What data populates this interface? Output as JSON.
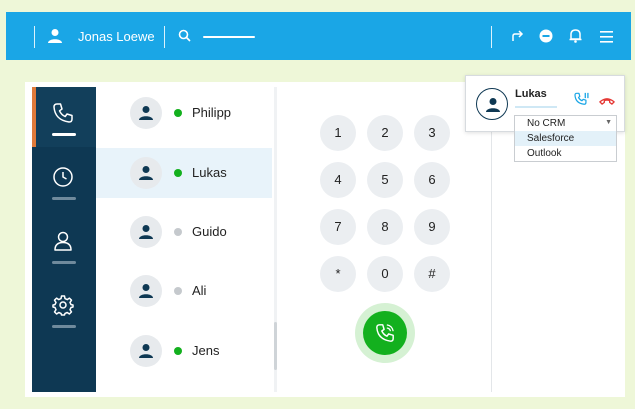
{
  "topbar": {
    "user_name": "Jonas Loewe",
    "icons": [
      "user-icon",
      "search-icon",
      "forward-icon",
      "dnd-icon",
      "bell-icon",
      "menu-icon"
    ]
  },
  "nav": {
    "items": [
      {
        "name": "phone",
        "icon": "phone-icon",
        "active": true
      },
      {
        "name": "history",
        "icon": "clock-icon",
        "active": false
      },
      {
        "name": "contacts",
        "icon": "person-icon",
        "active": false
      },
      {
        "name": "settings",
        "icon": "gear-icon",
        "active": false
      }
    ]
  },
  "contacts": [
    {
      "name": "Philipp",
      "status": "online"
    },
    {
      "name": "Lukas",
      "status": "online",
      "selected": true
    },
    {
      "name": "Guido",
      "status": "offline"
    },
    {
      "name": "Ali",
      "status": "offline"
    },
    {
      "name": "Jens",
      "status": "online"
    }
  ],
  "dialpad": {
    "keys": [
      "1",
      "2",
      "3",
      "4",
      "5",
      "6",
      "7",
      "8",
      "9",
      "*",
      "0",
      "#"
    ]
  },
  "popup": {
    "contact_name": "Lukas",
    "crm": {
      "selected": "No CRM",
      "options": [
        "Salesforce",
        "Outlook"
      ]
    }
  },
  "colors": {
    "topbar": "#1aa6e6",
    "nav_bg": "#0e3853",
    "nav_accent": "#e07a3a",
    "online": "#13b01e",
    "offline": "#c5c9cd",
    "call_button": "#13b01e",
    "hangup": "#e53935"
  }
}
